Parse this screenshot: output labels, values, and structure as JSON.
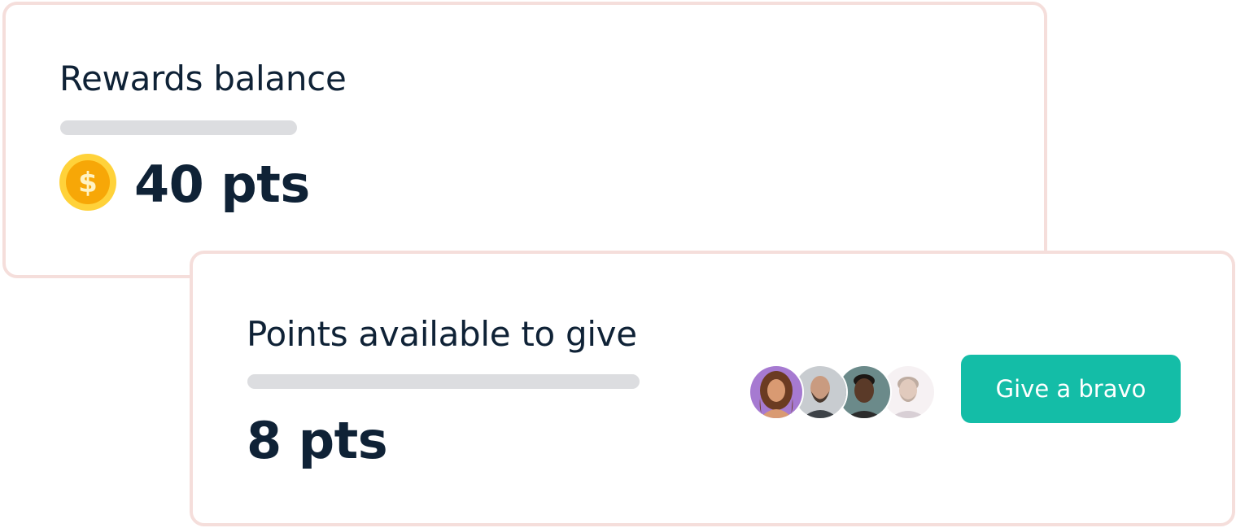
{
  "rewards": {
    "title": "Rewards balance",
    "points": "40 pts",
    "coin_icon": "dollar-coin-icon",
    "coin_symbol": "$"
  },
  "give": {
    "title": "Points available to give",
    "points": "8 pts",
    "avatars": [
      {
        "name": "avatar-woman-curly-hair",
        "bg": "#a67ad1"
      },
      {
        "name": "avatar-man-bald-beard",
        "bg": "#c8ccd0"
      },
      {
        "name": "avatar-man-dark",
        "bg": "#6b8a8a"
      },
      {
        "name": "avatar-man-faded",
        "bg": "#efe6ea"
      }
    ],
    "button_label": "Give a bravo"
  },
  "colors": {
    "card_border": "#f5dedb",
    "text": "#0f2236",
    "placeholder": "#dcdde0",
    "accent": "#14bda7",
    "coin": "#f7a707",
    "coin_rim": "#ffd23a"
  }
}
